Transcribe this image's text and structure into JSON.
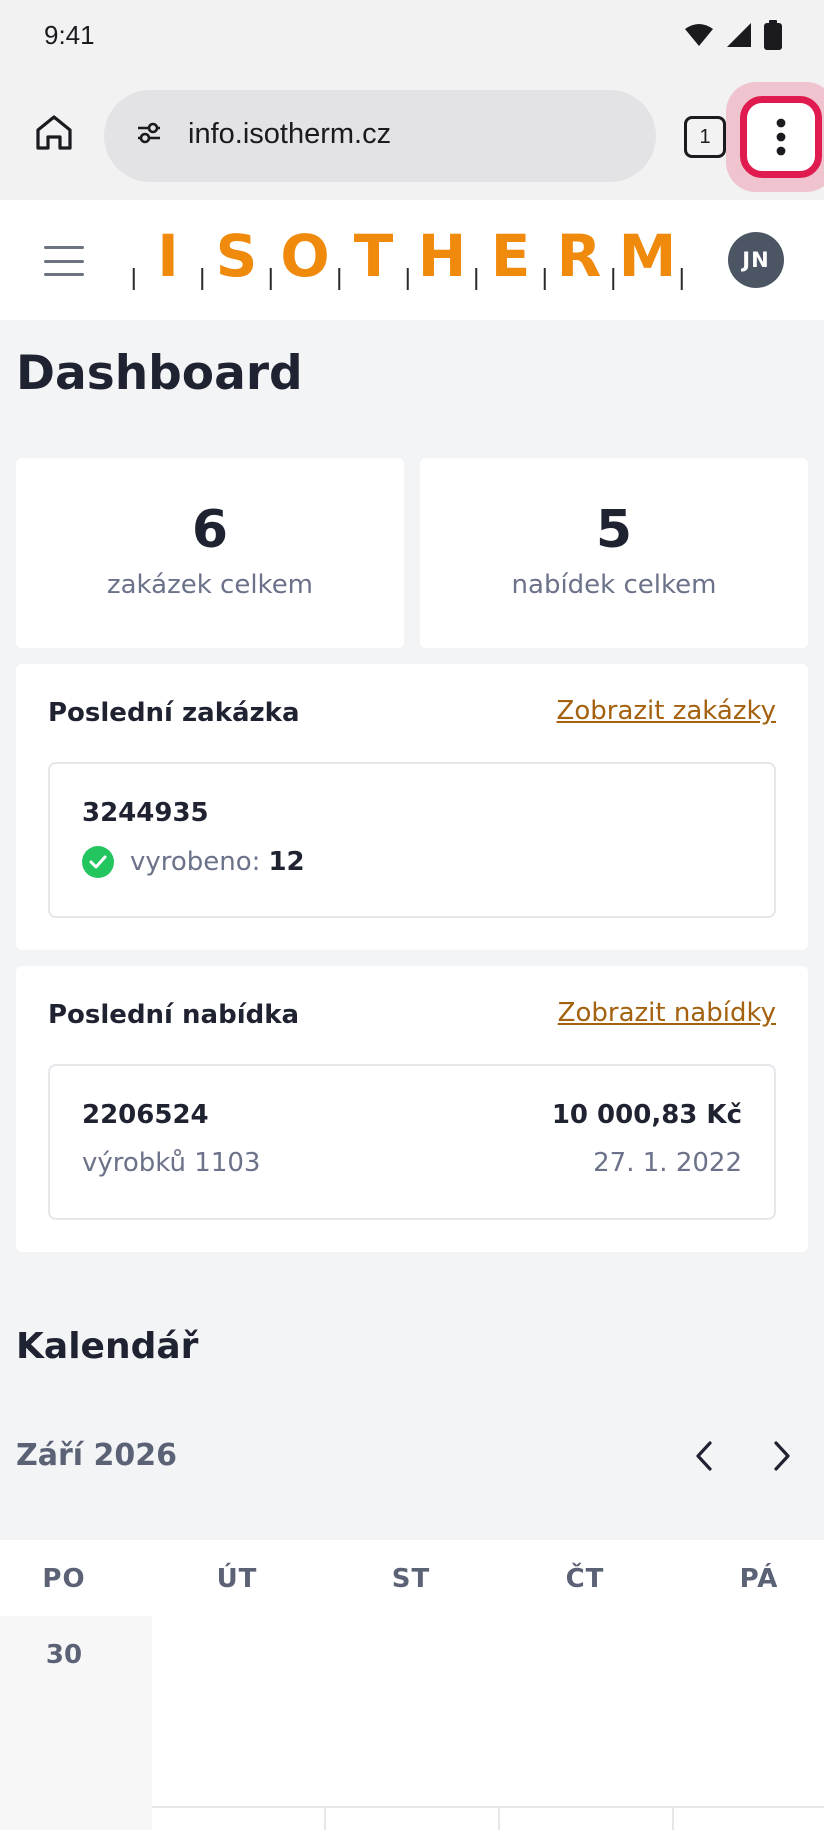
{
  "status_bar": {
    "time": "9:41"
  },
  "browser": {
    "url": "info.isotherm.cz",
    "tab_count": "1"
  },
  "header": {
    "logo_text": "ISOTHERM",
    "avatar_initials": "JN",
    "brand_color": "#f08a0c"
  },
  "page": {
    "title": "Dashboard"
  },
  "stats": [
    {
      "value": "6",
      "label": "zakázek celkem"
    },
    {
      "value": "5",
      "label": "nabídek celkem"
    }
  ],
  "last_order": {
    "title": "Poslední zakázka",
    "link": "Zobrazit zakázky",
    "number": "3244935",
    "status_label": "vyrobeno:",
    "status_count": "12"
  },
  "last_offer": {
    "title": "Poslední nabídka",
    "link": "Zobrazit nabídky",
    "number": "2206524",
    "items": "výrobků 1103",
    "price": "10 000,83 Kč",
    "date": "27. 1. 2022"
  },
  "calendar": {
    "title": "Kalendář",
    "month": "Září 2026",
    "weekdays": [
      "PO",
      "ÚT",
      "ST",
      "ČT",
      "PÁ"
    ],
    "first_date": "30"
  }
}
